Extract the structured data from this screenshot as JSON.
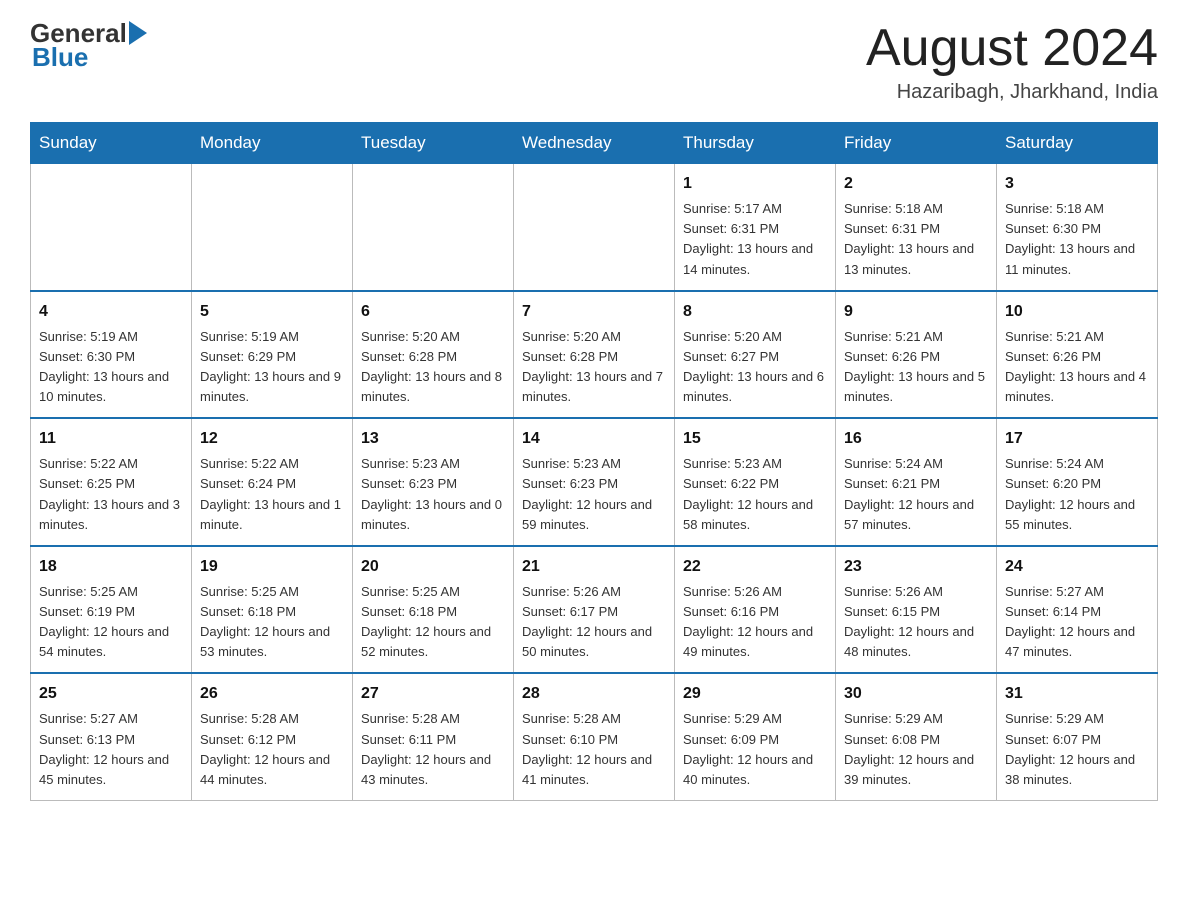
{
  "header": {
    "logo_general": "General",
    "logo_blue": "Blue",
    "title": "August 2024",
    "location": "Hazaribagh, Jharkhand, India"
  },
  "days_of_week": [
    "Sunday",
    "Monday",
    "Tuesday",
    "Wednesday",
    "Thursday",
    "Friday",
    "Saturday"
  ],
  "weeks": [
    [
      {
        "day": "",
        "info": ""
      },
      {
        "day": "",
        "info": ""
      },
      {
        "day": "",
        "info": ""
      },
      {
        "day": "",
        "info": ""
      },
      {
        "day": "1",
        "info": "Sunrise: 5:17 AM\nSunset: 6:31 PM\nDaylight: 13 hours and 14 minutes."
      },
      {
        "day": "2",
        "info": "Sunrise: 5:18 AM\nSunset: 6:31 PM\nDaylight: 13 hours and 13 minutes."
      },
      {
        "day": "3",
        "info": "Sunrise: 5:18 AM\nSunset: 6:30 PM\nDaylight: 13 hours and 11 minutes."
      }
    ],
    [
      {
        "day": "4",
        "info": "Sunrise: 5:19 AM\nSunset: 6:30 PM\nDaylight: 13 hours and 10 minutes."
      },
      {
        "day": "5",
        "info": "Sunrise: 5:19 AM\nSunset: 6:29 PM\nDaylight: 13 hours and 9 minutes."
      },
      {
        "day": "6",
        "info": "Sunrise: 5:20 AM\nSunset: 6:28 PM\nDaylight: 13 hours and 8 minutes."
      },
      {
        "day": "7",
        "info": "Sunrise: 5:20 AM\nSunset: 6:28 PM\nDaylight: 13 hours and 7 minutes."
      },
      {
        "day": "8",
        "info": "Sunrise: 5:20 AM\nSunset: 6:27 PM\nDaylight: 13 hours and 6 minutes."
      },
      {
        "day": "9",
        "info": "Sunrise: 5:21 AM\nSunset: 6:26 PM\nDaylight: 13 hours and 5 minutes."
      },
      {
        "day": "10",
        "info": "Sunrise: 5:21 AM\nSunset: 6:26 PM\nDaylight: 13 hours and 4 minutes."
      }
    ],
    [
      {
        "day": "11",
        "info": "Sunrise: 5:22 AM\nSunset: 6:25 PM\nDaylight: 13 hours and 3 minutes."
      },
      {
        "day": "12",
        "info": "Sunrise: 5:22 AM\nSunset: 6:24 PM\nDaylight: 13 hours and 1 minute."
      },
      {
        "day": "13",
        "info": "Sunrise: 5:23 AM\nSunset: 6:23 PM\nDaylight: 13 hours and 0 minutes."
      },
      {
        "day": "14",
        "info": "Sunrise: 5:23 AM\nSunset: 6:23 PM\nDaylight: 12 hours and 59 minutes."
      },
      {
        "day": "15",
        "info": "Sunrise: 5:23 AM\nSunset: 6:22 PM\nDaylight: 12 hours and 58 minutes."
      },
      {
        "day": "16",
        "info": "Sunrise: 5:24 AM\nSunset: 6:21 PM\nDaylight: 12 hours and 57 minutes."
      },
      {
        "day": "17",
        "info": "Sunrise: 5:24 AM\nSunset: 6:20 PM\nDaylight: 12 hours and 55 minutes."
      }
    ],
    [
      {
        "day": "18",
        "info": "Sunrise: 5:25 AM\nSunset: 6:19 PM\nDaylight: 12 hours and 54 minutes."
      },
      {
        "day": "19",
        "info": "Sunrise: 5:25 AM\nSunset: 6:18 PM\nDaylight: 12 hours and 53 minutes."
      },
      {
        "day": "20",
        "info": "Sunrise: 5:25 AM\nSunset: 6:18 PM\nDaylight: 12 hours and 52 minutes."
      },
      {
        "day": "21",
        "info": "Sunrise: 5:26 AM\nSunset: 6:17 PM\nDaylight: 12 hours and 50 minutes."
      },
      {
        "day": "22",
        "info": "Sunrise: 5:26 AM\nSunset: 6:16 PM\nDaylight: 12 hours and 49 minutes."
      },
      {
        "day": "23",
        "info": "Sunrise: 5:26 AM\nSunset: 6:15 PM\nDaylight: 12 hours and 48 minutes."
      },
      {
        "day": "24",
        "info": "Sunrise: 5:27 AM\nSunset: 6:14 PM\nDaylight: 12 hours and 47 minutes."
      }
    ],
    [
      {
        "day": "25",
        "info": "Sunrise: 5:27 AM\nSunset: 6:13 PM\nDaylight: 12 hours and 45 minutes."
      },
      {
        "day": "26",
        "info": "Sunrise: 5:28 AM\nSunset: 6:12 PM\nDaylight: 12 hours and 44 minutes."
      },
      {
        "day": "27",
        "info": "Sunrise: 5:28 AM\nSunset: 6:11 PM\nDaylight: 12 hours and 43 minutes."
      },
      {
        "day": "28",
        "info": "Sunrise: 5:28 AM\nSunset: 6:10 PM\nDaylight: 12 hours and 41 minutes."
      },
      {
        "day": "29",
        "info": "Sunrise: 5:29 AM\nSunset: 6:09 PM\nDaylight: 12 hours and 40 minutes."
      },
      {
        "day": "30",
        "info": "Sunrise: 5:29 AM\nSunset: 6:08 PM\nDaylight: 12 hours and 39 minutes."
      },
      {
        "day": "31",
        "info": "Sunrise: 5:29 AM\nSunset: 6:07 PM\nDaylight: 12 hours and 38 minutes."
      }
    ]
  ]
}
